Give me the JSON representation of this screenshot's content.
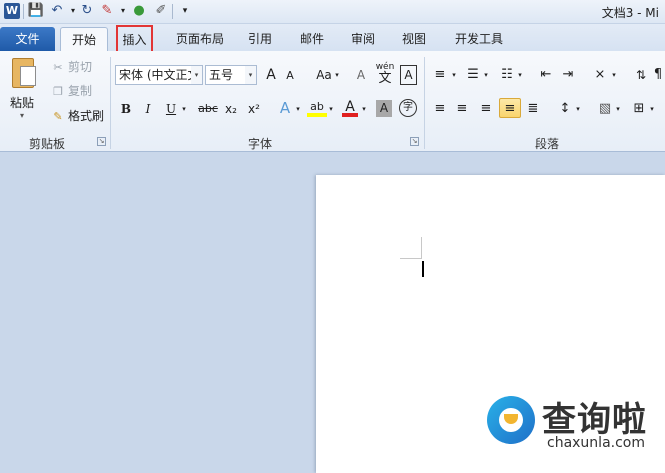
{
  "window": {
    "title": "文档3 - Mi",
    "app_icon": "W"
  },
  "quick_access": {
    "items": [
      "save-icon",
      "undo-icon",
      "redo-icon",
      "format-painter-icon",
      "color-wheel-icon",
      "pen-icon",
      "customize-arrow-icon"
    ]
  },
  "tabs": {
    "file": "文件",
    "items": [
      "开始",
      "插入",
      "页面布局",
      "引用",
      "邮件",
      "审阅",
      "视图",
      "开发工具"
    ],
    "active": "开始",
    "highlighted": "插入",
    "highlight_color": "#e23535"
  },
  "clipboard": {
    "paste": "粘贴",
    "cut": "剪切",
    "copy": "复制",
    "format_painter": "格式刷",
    "group_label": "剪贴板"
  },
  "font": {
    "font_name": "宋体 (中文正文",
    "font_size": "五号",
    "grow_font": "A",
    "shrink_font": "A",
    "change_case": "Aa",
    "clear_format": "A",
    "phonetic": "wén",
    "phonetic_char": "文",
    "char_border": "A",
    "bold": "B",
    "italic": "I",
    "underline": "U",
    "strikethrough": "abc",
    "subscript": "x₂",
    "superscript": "x²",
    "text_effects": "A",
    "highlight": "ab",
    "font_color": "A",
    "char_shading": "A",
    "enclose": "字",
    "group_label": "字体"
  },
  "paragraph": {
    "group_label": "段落",
    "alignment_selected": "justify"
  },
  "watermark": {
    "name": "查询啦",
    "url": "chaxunla.com"
  }
}
